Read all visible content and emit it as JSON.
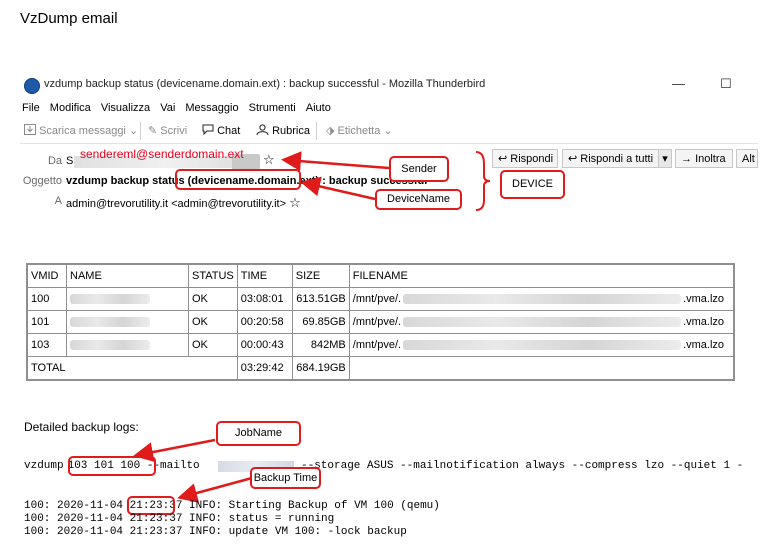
{
  "page_title": "VzDump email",
  "window": {
    "title": "vzdump backup status (devicename.domain.ext) : backup successful - Mozilla Thunderbird",
    "min_glyph": "—",
    "max_glyph": "☐"
  },
  "menu": [
    "File",
    "Modifica",
    "Visualizza",
    "Vai",
    "Messaggio",
    "Strumenti",
    "Aiuto"
  ],
  "toolbar": {
    "get_messages": "Scarica messaggi",
    "write": "Scrivi",
    "chat": "Chat",
    "address_book": "Rubrica",
    "tag": "Etichetta"
  },
  "message": {
    "from_label": "Da",
    "from_value": "S",
    "subject_label": "Oggetto",
    "subject_prefix": "vzdump backup status ",
    "subject_device": "(devicename.domain.ext)",
    "subject_suffix": " : backup successful",
    "to_label": "A",
    "to_value": "admin@trevorutility.it <admin@trevorutility.it>",
    "reply": "Rispondi",
    "reply_all": "Rispondi a tutti",
    "forward": "Inoltra",
    "other": "Alt"
  },
  "annotations": {
    "sender_email": "sendereml@senderdomain.ext",
    "sender": "Sender",
    "device_name": "DeviceName",
    "device": "DEVICE",
    "job_name": "JobName",
    "backup_time": "Backup Time"
  },
  "table": {
    "headers": [
      "VMID",
      "NAME",
      "STATUS",
      "TIME",
      "SIZE",
      "FILENAME"
    ],
    "rows": [
      {
        "vmid": "100",
        "status": "OK",
        "time": "03:08:01",
        "size": "613.51GB",
        "file_prefix": "/mnt/pve/.",
        "file_suffix": ".vma.lzo"
      },
      {
        "vmid": "101",
        "status": "OK",
        "time": "00:20:58",
        "size": "69.85GB",
        "file_prefix": "/mnt/pve/.",
        "file_suffix": ".vma.lzo"
      },
      {
        "vmid": "103",
        "status": "OK",
        "time": "00:00:43",
        "size": "842MB",
        "file_prefix": "/mnt/pve/.",
        "file_suffix": ".vma.lzo"
      }
    ],
    "total_label": "TOTAL",
    "total_time": "03:29:42",
    "total_size": "684.19GB"
  },
  "logs": {
    "title": "Detailed backup logs:",
    "cmd_start": "vzdump",
    "cmd_jobs": "103 101 100",
    "cmd_mailto": "--mailto",
    "cmd_rest": "--storage ASUS --mailnotification always --compress lzo --quiet 1 -",
    "line1_pre": "100: 2020-11-04 ",
    "line1_time": "21:23",
    "line1_post": ":37 INFO: Starting Backup of VM 100 (qemu)",
    "line2": "100: 2020-11-04 21:23:37 INFO: status = running",
    "line3": "100: 2020-11-04 21:23:37 INFO: update VM 100: -lock backup"
  }
}
